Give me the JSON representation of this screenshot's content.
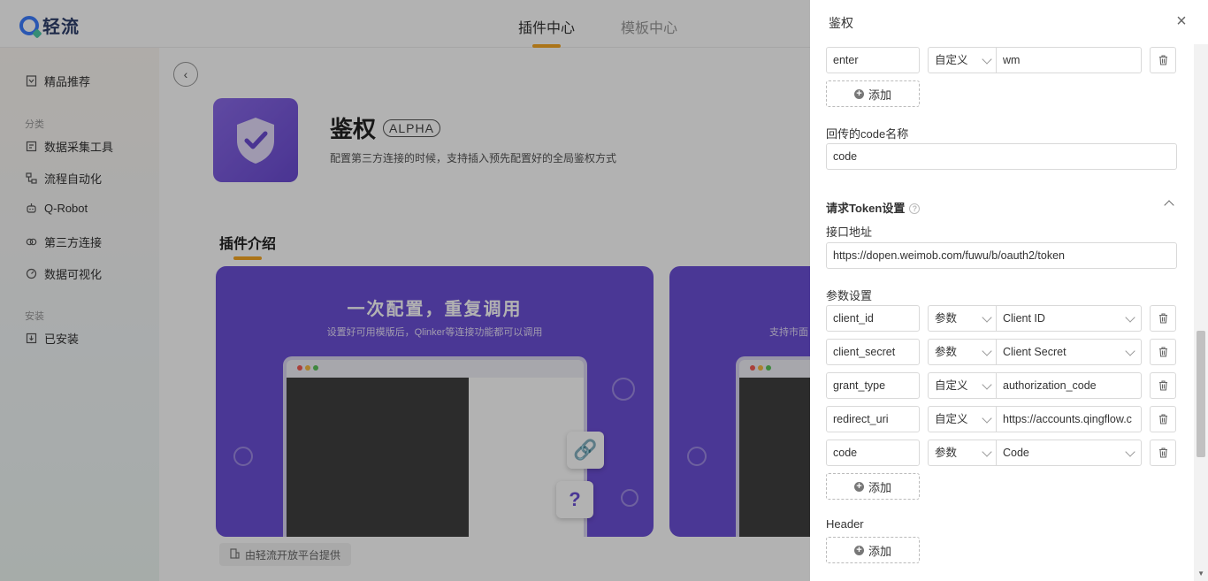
{
  "app": {
    "logo_text": "轻流",
    "top_tabs": [
      {
        "label": "插件中心",
        "active": true
      },
      {
        "label": "模板中心",
        "active": false
      }
    ]
  },
  "sidebar": {
    "featured": "精品推荐",
    "group_category": "分类",
    "categories": [
      "数据采集工具",
      "流程自动化",
      "Q-Robot",
      "第三方连接",
      "数据可视化"
    ],
    "group_installed": "安装",
    "installed": "已安装"
  },
  "plugin": {
    "name": "鉴权",
    "badge": "ALPHA",
    "description": "配置第三方连接的时候，支持插入预先配置好的全局鉴权方式",
    "intro_title": "插件介绍",
    "banner_title": "一次配置，重复调用",
    "banner_subtitle": "设置好可用模版后，Qlinker等连接功能都可以调用",
    "banner2_subtitle": "支持市面",
    "provider": "由轻流开放平台提供"
  },
  "drawer": {
    "title": "鉴权",
    "top_param": {
      "key": "enter",
      "type": "自定义",
      "value": "wm"
    },
    "add_label": "添加",
    "callback_code_label": "回传的code名称",
    "callback_code_value": "code",
    "token_section_title": "请求Token设置",
    "endpoint_label": "接口地址",
    "endpoint_value": "https://dopen.weimob.com/fuwu/b/oauth2/token",
    "params_label": "参数设置",
    "params": [
      {
        "key": "client_id",
        "type": "参数",
        "value": "Client ID",
        "value_is_select": true
      },
      {
        "key": "client_secret",
        "type": "参数",
        "value": "Client Secret",
        "value_is_select": true
      },
      {
        "key": "grant_type",
        "type": "自定义",
        "value": "authorization_code",
        "value_is_select": false
      },
      {
        "key": "redirect_uri",
        "type": "自定义",
        "value": "https://accounts.qingflow.c",
        "value_is_select": false
      },
      {
        "key": "code",
        "type": "参数",
        "value": "Code",
        "value_is_select": true
      }
    ],
    "header_label": "Header"
  },
  "colors": {
    "accent": "#f5a623",
    "banner": "#6b4fd6",
    "brand": "#3d7dff"
  }
}
